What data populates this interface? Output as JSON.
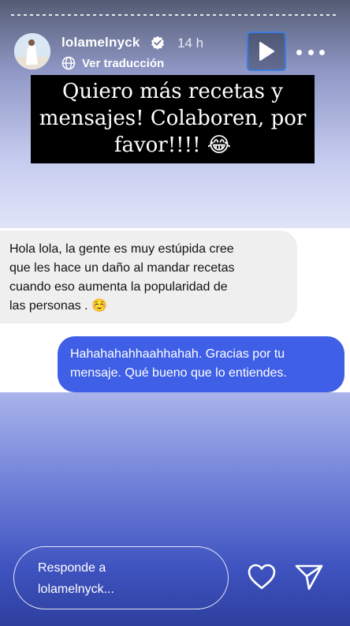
{
  "header": {
    "username": "lolamelnyck",
    "time": "14 h",
    "translate_label": "Ver traducción"
  },
  "caption": {
    "line1": "Quiero más recetas y",
    "line2": "mensajes! Colaboren, por",
    "line3": "favor!!!!",
    "emoji": "😂"
  },
  "chat": {
    "received": {
      "line1": "Hola lola, la gente es muy estúpida cree",
      "line2": "que les hace un daño al mandar recetas",
      "line3": "cuando eso aumenta la popularidad de",
      "line4": "las personas .",
      "emoji": "☺️"
    },
    "sent": {
      "line1": "Hahahahahhaahhahah. Gracias por tu",
      "line2": "mensaje. Qué bueno que lo entiendes."
    }
  },
  "reply": {
    "line1": "Responde a",
    "line2": "lolamelnyck..."
  },
  "icons": {
    "verified": "verified-badge-icon",
    "globe": "globe-icon",
    "play": "play-icon",
    "more": "more-icon",
    "heart": "heart-icon",
    "send": "send-icon"
  },
  "colors": {
    "sent_bubble": "#3f5fe6",
    "received_bubble": "#efefef",
    "caption_bg": "#000000",
    "play_border": "#3c7ce0"
  }
}
